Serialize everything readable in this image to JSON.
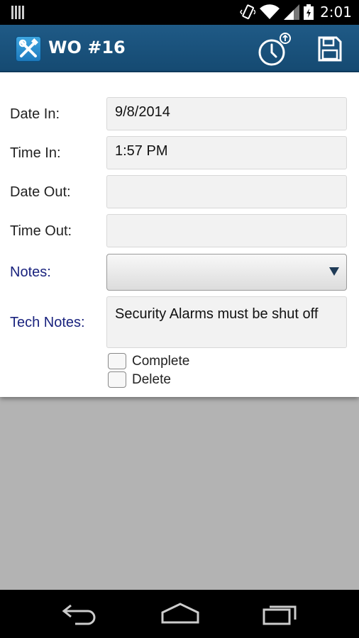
{
  "status_bar": {
    "time": "2:01",
    "icons": [
      "notification-icon",
      "vibrate-icon",
      "wifi-icon",
      "signal-icon",
      "battery-icon"
    ]
  },
  "action_bar": {
    "title": "WO #16",
    "icons": [
      "tools-icon",
      "clock-upload-icon",
      "save-icon"
    ]
  },
  "form": {
    "date_in_label": "Date In:",
    "date_in_value": "9/8/2014",
    "time_in_label": "Time In:",
    "time_in_value": "1:57 PM",
    "date_out_label": "Date Out:",
    "date_out_value": "",
    "time_out_label": "Time Out:",
    "time_out_value": "",
    "notes_label": "Notes:",
    "notes_value": "",
    "tech_notes_label": "Tech Notes:",
    "tech_notes_value": "Security Alarms must be shut off",
    "complete_label": "Complete",
    "delete_label": "Delete"
  },
  "colors": {
    "action_bar": "#1a5480",
    "label_blue": "#1a237e",
    "background_gray": "#b3b3b3"
  },
  "nav_bar": {
    "icons": [
      "back-icon",
      "home-icon",
      "recents-icon"
    ]
  }
}
